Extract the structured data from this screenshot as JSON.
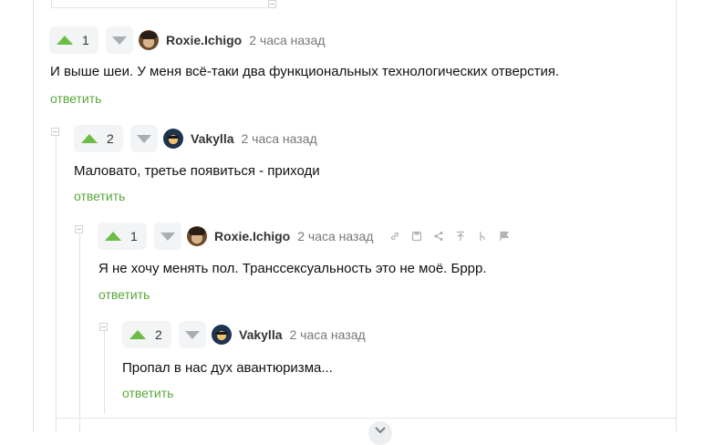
{
  "comments": [
    {
      "votes": "1",
      "user": "Roxie.Ichigo",
      "time": "2 часа назад",
      "text": "И выше шеи. У меня всё-таки два функциональных технологических отверстия.",
      "reply": "ответить"
    },
    {
      "votes": "2",
      "user": "Vakylla",
      "time": "2 часа назад",
      "text": "Маловато, третье появиться - приходи",
      "reply": "ответить"
    },
    {
      "votes": "1",
      "user": "Roxie.Ichigo",
      "time": "2 часа назад",
      "text": "Я не хочу менять пол. Транссексуальность это не моё. Бррр.",
      "reply": "ответить",
      "tools": [
        "link-icon",
        "save-icon",
        "share-icon",
        "scroll-up-icon",
        "branch-icon",
        "flag-icon"
      ]
    },
    {
      "votes": "2",
      "user": "Vakylla",
      "time": "2 часа назад",
      "text": "Пропал в нас дух авантюризма...",
      "reply": "ответить"
    }
  ],
  "colors": {
    "upvote": "#6cbd45",
    "reply_link": "#5aa63a",
    "downvote": "#a9aeb3"
  }
}
